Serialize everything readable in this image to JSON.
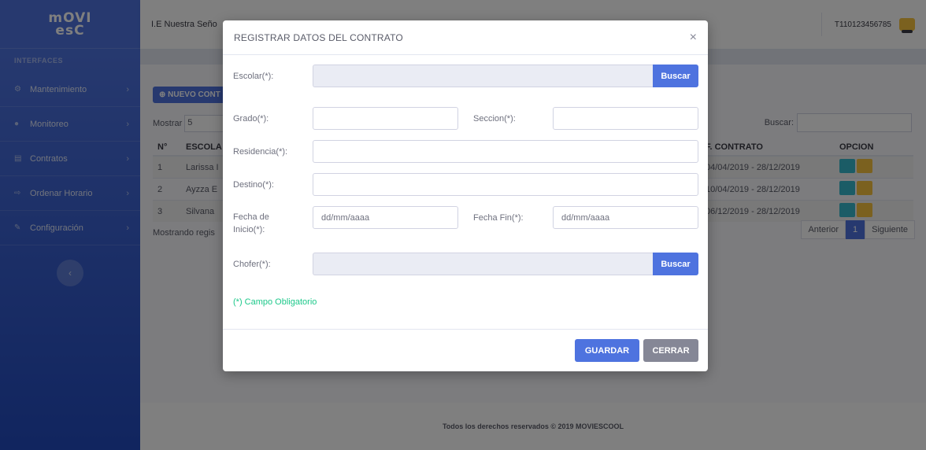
{
  "sidebar": {
    "brand_line1": "mOVI",
    "brand_line2": "esC",
    "heading": "INTERFACES",
    "items": [
      {
        "icon": "gear-icon",
        "label": "Mantenimiento"
      },
      {
        "icon": "map-marker-icon",
        "label": "Monitoreo"
      },
      {
        "icon": "file-icon",
        "label": "Contratos"
      },
      {
        "icon": "sign-in-icon",
        "label": "Ordenar Horario"
      },
      {
        "icon": "wrench-icon",
        "label": "Configuración"
      }
    ]
  },
  "topbar": {
    "school": "I.E Nuestra Seño",
    "user_id": "T110123456785"
  },
  "background": {
    "new_button": "NUEVO CONT",
    "show_label": "Mostrar",
    "show_value": "5",
    "search_label": "Buscar:",
    "table": {
      "headers": [
        "N°",
        "ESCOLA",
        "F. CONTRATO",
        "OPCION"
      ],
      "rows": [
        {
          "n": "1",
          "name": "Larissa I",
          "date": "04/04/2019 - 28/12/2019"
        },
        {
          "n": "2",
          "name": "Ayzza E",
          "date": "10/04/2019 - 28/12/2019"
        },
        {
          "n": "3",
          "name": "Silvana",
          "date": "06/12/2019 - 28/12/2019"
        }
      ]
    },
    "info": "Mostrando regis",
    "pager": {
      "prev": "Anterior",
      "page": "1",
      "next": "Siguiente"
    },
    "footer": "Todos los derechos reservados © 2019 MOVIESCOOL"
  },
  "modal": {
    "title": "REGISTRAR DATOS DEL CONTRATO",
    "close": "×",
    "escolar_label": "Escolar(*):",
    "buscar": "Buscar",
    "grado_label": "Grado(*):",
    "seccion_label": "Seccion(*):",
    "residencia_label": "Residencia(*):",
    "destino_label": "Destino(*):",
    "fecha_inicio_label_1": "Fecha de",
    "fecha_inicio_label_2": "Inicio(*):",
    "fecha_inicio_placeholder": "dd/mm/aaaa",
    "fecha_fin_label": "Fecha Fin(*):",
    "fecha_fin_placeholder": "dd/mm/aaaa",
    "chofer_label": "Chofer(*):",
    "required_note": "(*) Campo Obligatorio",
    "save": "GUARDAR",
    "cancel": "CERRAR"
  }
}
